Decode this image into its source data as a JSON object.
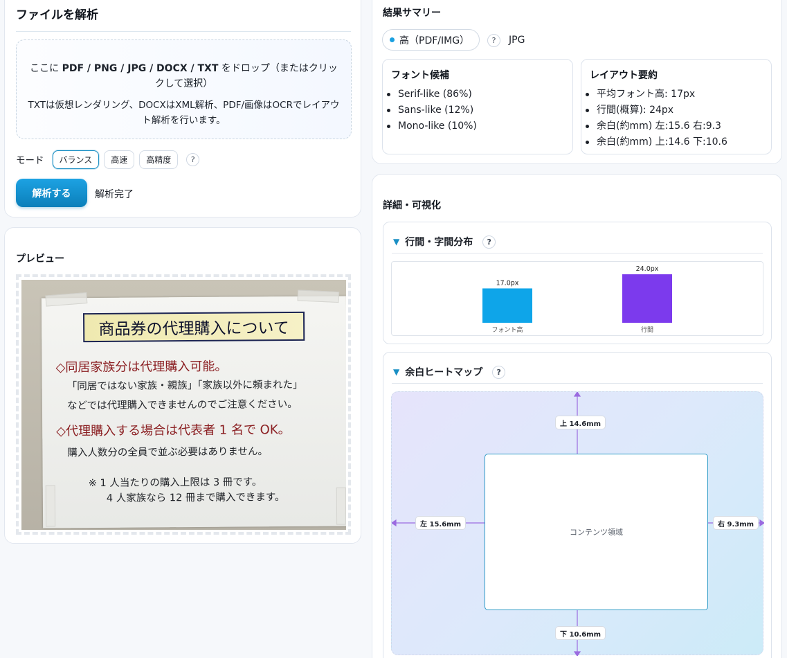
{
  "upload": {
    "title": "ファイルを解析",
    "drop_prefix": "ここに ",
    "drop_formats": "PDF / PNG / JPG / DOCX / TXT",
    "drop_suffix": " をドロップ（またはクリックして選択）",
    "drop_note": "TXTは仮想レンダリング、DOCXはXML解析、PDF/画像はOCRでレイアウト解析を行います。",
    "mode_label": "モード",
    "modes": [
      "バランス",
      "高速",
      "高精度"
    ],
    "selected_mode": "バランス",
    "help": "?",
    "analyze_button": "解析する",
    "status": "解析完了"
  },
  "preview": {
    "title": "プレビュー",
    "notice": {
      "heading": "商品券の代理購入について",
      "line1": "◇同居家族分は代理購入可能。",
      "line2": "「同居ではない家族・親族」「家族以外に頼まれた」",
      "line3": "などでは代理購入できませんのでご注意ください。",
      "line4": "◇代理購入する場合は代表者 1 名で OK。",
      "line5": "購入人数分の全員で並ぶ必要はありません。",
      "line6": "※ 1 人当たりの購入上限は 3 冊です。",
      "line7": "4 人家族なら 12 冊まで購入できます。"
    }
  },
  "summary": {
    "title": "結果サマリー",
    "quality": "高（PDF/IMG）",
    "help": "?",
    "format": "JPG",
    "font_box": {
      "title": "フォント候補",
      "items": [
        "Serif-like (86%)",
        "Sans-like (12%)",
        "Mono-like (10%)"
      ]
    },
    "layout_box": {
      "title": "レイアウト要約",
      "items": [
        "平均フォント高: 17px",
        "行間(概算): 24px",
        "余白(約mm) 左:15.6 右:9.3",
        "余白(約mm) 上:14.6 下:10.6"
      ]
    }
  },
  "details": {
    "title": "詳細・可視化",
    "spacing": {
      "title": "行間・字間分布",
      "help": "?"
    },
    "heatmap": {
      "title": "余白ヒートマップ",
      "help": "?",
      "content_label": "コンテンツ領域",
      "top": "上 14.6mm",
      "bottom": "下 10.6mm",
      "left": "左 15.6mm",
      "right": "右 9.3mm",
      "arrow_color": "#9b6be0"
    }
  },
  "chart_data": {
    "type": "bar",
    "categories": [
      "フォント高",
      "行間"
    ],
    "values": [
      17.0,
      24.0
    ],
    "value_labels": [
      "17.0px",
      "24.0px"
    ],
    "colors": [
      "#0ea5e9",
      "#7c3aed"
    ],
    "ylim": [
      0,
      24
    ]
  }
}
